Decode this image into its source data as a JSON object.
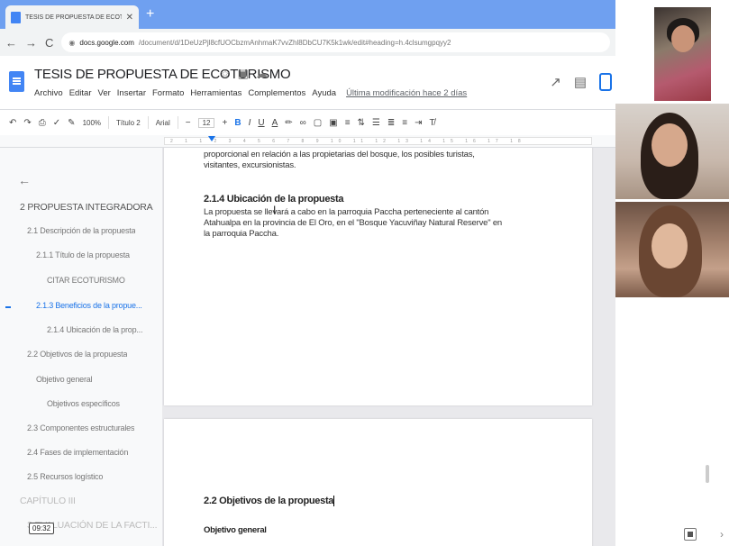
{
  "browser": {
    "tab_title": "TESIS DE PROPUESTA DE ECOTU",
    "tab_close": "✕",
    "new_tab": "+",
    "back": "←",
    "forward": "→",
    "reload": "C",
    "url_domain": "docs.google.com",
    "url_path": "/document/d/1DeUzPjl8cfUOCbzmAnhmaK7vvZhl8DbCU7K5k1wk/edit#heading=h.4clsumgpqyy2"
  },
  "docs": {
    "title": "TESIS DE PROPUESTA DE ECOTURISMO",
    "title_icons": [
      "star-icon",
      "folder-icon",
      "cloud-icon"
    ],
    "menus": [
      "Archivo",
      "Editar",
      "Ver",
      "Insertar",
      "Formato",
      "Herramientas",
      "Complementos",
      "Ayuda"
    ],
    "last_modified": "Última modificación hace 2 días"
  },
  "toolbar": {
    "zoom": "100%",
    "style": "Título 2",
    "font": "Arial",
    "font_size": "12",
    "ruler_numbers": "2 1 1 2 3 4 5 6 7 8 9 10 11 12 13 14 15 16 17 18"
  },
  "outline": {
    "back_arrow": "←",
    "items": [
      {
        "label": "2 PROPUESTA INTEGRADORA",
        "level": "h1"
      },
      {
        "label": "2.1 Descripción de la propuesta",
        "level": "h2"
      },
      {
        "label": "2.1.1 Título de la propuesta",
        "level": "h3"
      },
      {
        "label": "CITAR ECOTURISMO",
        "level": "h4"
      },
      {
        "label": "2.1.3 Beneficios de la propue...",
        "level": "h3"
      },
      {
        "label": "2.1.4 Ubicación de la prop...",
        "level": "h4"
      },
      {
        "label": "2.2 Objetivos de la propuesta",
        "level": "h2"
      },
      {
        "label": "Objetivo general",
        "level": "h3"
      },
      {
        "label": "Objetivos específicos",
        "level": "h4"
      },
      {
        "label": "2.3 Componentes estructurales",
        "level": "h2"
      },
      {
        "label": "2.4 Fases de implementación",
        "level": "h2"
      },
      {
        "label": "2.5 Recursos logístico",
        "level": "h2"
      },
      {
        "label": "CAPÍTULO III",
        "level": "dim"
      },
      {
        "label": "3 EVALUACIÓN DE LA FACTI...",
        "level": "dim"
      }
    ]
  },
  "page1": {
    "para_top": "proporcional en relación a las propietarias del bosque, los posibles turistas, visitantes, excursionistas.",
    "heading": "2.1.4 Ubicación de la propuesta",
    "body": "La propuesta se llevará a cabo en la parroquia Paccha perteneciente al cantón Atahualpa en la provincia de El Oro, en el \"Bosque Yacuviñay Natural Reserve\" en la parroquia Paccha."
  },
  "page2": {
    "heading": "2.2 Objetivos de la propuesta",
    "subheading": "Objetivo general"
  },
  "clock": "09:32"
}
